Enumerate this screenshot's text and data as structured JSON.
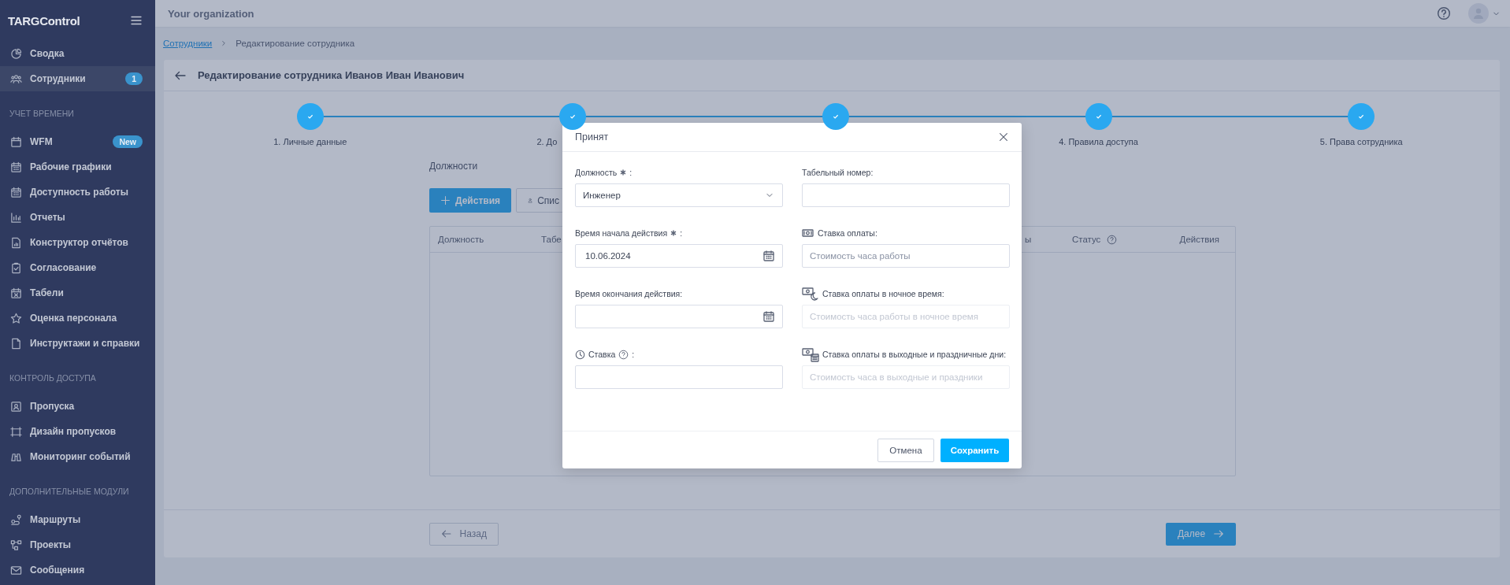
{
  "sidebar": {
    "logo": "TARGControl",
    "sections": [
      {
        "items": [
          {
            "label": "Сводка",
            "selected": false
          },
          {
            "label": "Сотрудники",
            "selected": true,
            "badge": "1"
          }
        ]
      },
      {
        "heading": "УЧЕТ ВРЕМЕНИ",
        "items": [
          {
            "label": "WFM",
            "selected": false,
            "badge": "New"
          },
          {
            "label": "Рабочие графики",
            "selected": false
          },
          {
            "label": "Доступность работы",
            "selected": false
          },
          {
            "label": "Отчеты",
            "selected": false
          },
          {
            "label": "Конструктор отчётов",
            "selected": false
          },
          {
            "label": "Согласование",
            "selected": false
          },
          {
            "label": "Табели",
            "selected": false
          },
          {
            "label": "Оценка персонала",
            "selected": false
          },
          {
            "label": "Инструктажи и справки",
            "selected": false
          }
        ]
      },
      {
        "heading": "КОНТРОЛЬ ДОСТУПА",
        "items": [
          {
            "label": "Пропуска",
            "selected": false
          },
          {
            "label": "Дизайн пропусков",
            "selected": false
          },
          {
            "label": "Мониторинг событий",
            "selected": false
          }
        ]
      },
      {
        "heading": "ДОПОЛНИТЕЛЬНЫЕ МОДУЛИ",
        "items": [
          {
            "label": "Маршруты",
            "selected": false
          },
          {
            "label": "Проекты",
            "selected": false
          },
          {
            "label": "Сообщения",
            "selected": false
          }
        ]
      }
    ]
  },
  "topbar": {
    "organization": "Your organization"
  },
  "breadcrumbs": [
    {
      "label": "Сотрудники",
      "link": true
    },
    {
      "label": "Редактирование сотрудника",
      "link": false
    }
  ],
  "page_title": "Редактирование сотрудника Иванов Иван Иванович",
  "steps": [
    {
      "label": "1. Личные данные",
      "completed": true,
      "covered": false
    },
    {
      "label": "2. До",
      "completed": true,
      "covered": true
    },
    {
      "completed": true
    },
    {
      "label": "4. Правила доступа",
      "completed": true,
      "covered": false
    },
    {
      "label": "5. Права сотрудника",
      "completed": true,
      "covered": false
    }
  ],
  "positions": {
    "title": "Должности",
    "buttons": [
      {
        "label": "Действия",
        "kind": "primary"
      },
      {
        "label": "Спис",
        "kind": "secondary"
      }
    ],
    "table": {
      "columns": [
        {
          "label": "Должность",
          "help": false
        },
        {
          "label": "Табе",
          "help": false
        },
        {
          "label": "ы",
          "help": false
        },
        {
          "label": "Статус",
          "help": true
        },
        {
          "label": "Действия",
          "help": false
        }
      ]
    }
  },
  "footer": {
    "buttons": [
      {
        "label": "Назад",
        "kind": "back"
      },
      {
        "label": "Далее",
        "kind": "next"
      }
    ]
  },
  "modal": {
    "title": "Принят",
    "fields": [
      {
        "kind": "select",
        "label": "Должность",
        "required": true,
        "help": false,
        "suffix": ":",
        "value": "Инженер",
        "disabled": false
      },
      {
        "kind": "text",
        "label": "Табельный номер:",
        "required": false,
        "help": false,
        "disabled": false
      },
      {
        "kind": "date",
        "label": "Время начала действия",
        "required": true,
        "help": false,
        "suffix": ":",
        "value": "10.06.2024",
        "disabled": false
      },
      {
        "kind": "text",
        "label": "Ставка оплаты:",
        "required": false,
        "help": false,
        "placeholder": "Стоимость часа работы",
        "disabled": false
      },
      {
        "kind": "date",
        "label": "Время окончания действия:",
        "required": false,
        "help": false,
        "disabled": false
      },
      {
        "kind": "text",
        "label": "Ставка оплаты в ночное время:",
        "required": false,
        "help": false,
        "placeholder": "Стоимость часа работы в ночное время",
        "disabled": true
      },
      {
        "kind": "text",
        "label": "Ставка",
        "required": false,
        "help": true,
        "suffix": ":",
        "disabled": false
      },
      {
        "kind": "text",
        "label": "Ставка оплаты в выходные и праздничные дни:",
        "required": false,
        "help": false,
        "placeholder": "Стоимость часа в выходные и праздники",
        "disabled": true
      }
    ],
    "buttons": [
      {
        "label": "Отмена",
        "kind": "secondary"
      },
      {
        "label": "Сохранить",
        "kind": "primary"
      }
    ]
  }
}
